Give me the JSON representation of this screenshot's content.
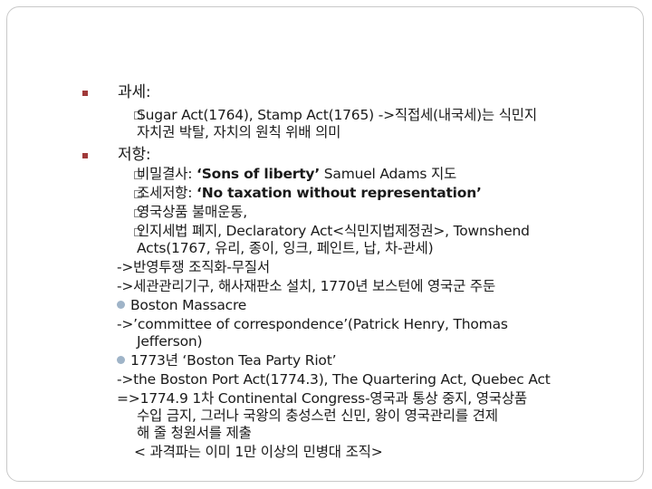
{
  "outline": {
    "h1": "과세:",
    "b1_line1": "Sugar Act(1764), Stamp Act(1765) ->직접세(내국세)는 식민지",
    "b1_line2": "자치권 박탈, 자치의 원칙 위배 의미",
    "h2": "저항:",
    "r1_pre": "비밀결사: ",
    "r1_bold": "‘Sons of liberty’",
    "r1_post": " Samuel Adams 지도",
    "r2_pre": "조세저항: ",
    "r2_bold": "‘No taxation without representation’",
    "r3": "영국상품 불매운동,",
    "r4_line1": "인지세법 폐지, Declaratory Act<식민지법제정권>, Townshend",
    "r4_line2": "Acts(1767, 유리, 종이, 잉크, 페인트, 납, 차-관세)",
    "c1": "->반영투쟁 조직화-무질서",
    "c2": "->세관관리기구, 해사재판소 설치, 1770년 보스턴에 영국군 주둔",
    "c3": "Boston Massacre",
    "c4": "->’committee of correspondence’(Patrick Henry, Thomas",
    "c5": "Jefferson)",
    "c6": "1773년 ‘Boston Tea Party Riot’",
    "c7": "->the Boston Port Act(1774.3), The Quartering Act, Quebec Act",
    "c8": "=>1774.9 1차 Continental Congress-영국과 통상 중지, 영국상품",
    "c9": "수입 금지, 그러나 국왕의 충성스런 신민, 왕이 영국관리를 견제",
    "c10": "해 줄 청원서를 제출",
    "c11": "< 과격파는 이미 1만 이상의 민병대 조직>"
  },
  "colors": {
    "level1_bullet": "#a03a3a",
    "dot_bullet": "#9fb4c8",
    "border": "#c9c9c9"
  }
}
